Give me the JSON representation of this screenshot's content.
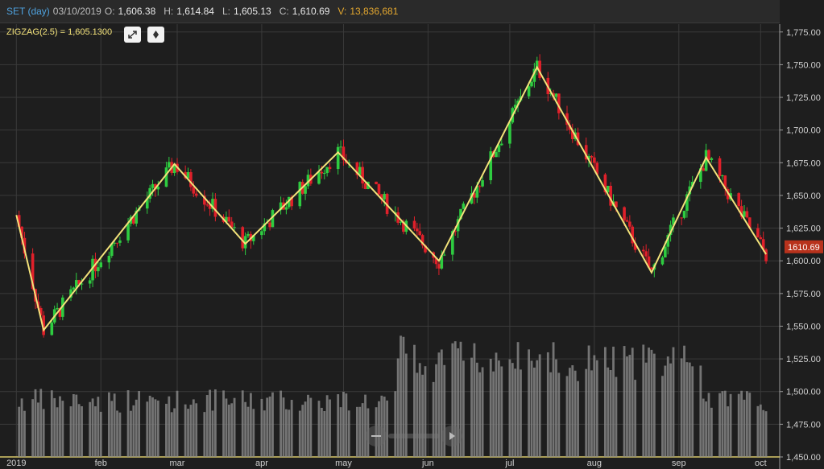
{
  "header": {
    "symbol": "SET (day)",
    "date": "03/10/2019",
    "open_label": "O:",
    "open": "1,606.38",
    "high_label": "H:",
    "high": "1,614.84",
    "low_label": "L:",
    "low": "1,605.13",
    "close_label": "C:",
    "close": "1,610.69",
    "volume_label": "V:",
    "volume": "13,836,681"
  },
  "indicator": {
    "label": "ZIGZAG(2.5) = 1,605.1300"
  },
  "controls": {
    "expand_icon": "expand-arrows-icon",
    "diamond_icon": "diamond-icon"
  },
  "colors": {
    "background": "#1e1e1e",
    "grid": "#3a3a3a",
    "up": "#2ecc40",
    "down": "#e0202a",
    "zigzag": "#f3e27a",
    "volume": "#8a8a8a",
    "last_price_tag": "#b8321c",
    "bottom_line": "#d9c86a"
  },
  "chart_data": {
    "type": "candlestick",
    "y_ticks": [
      "1,775.00",
      "1,750.00",
      "1,725.00",
      "1,700.00",
      "1,675.00",
      "1,650.00",
      "1,625.00",
      "1,600.00",
      "1,575.00",
      "1,550.00",
      "1,525.00",
      "1,500.00",
      "1,475.00",
      "1,450.00"
    ],
    "ylim": [
      1450,
      1781
    ],
    "x_ticks": [
      "2019",
      "feb",
      "mar",
      "apr",
      "may",
      "jun",
      "jul",
      "aug",
      "sep",
      "oct"
    ],
    "last_price": "1610.69",
    "zigzag_points": [
      {
        "x": "2019-01-01",
        "y": 1635
      },
      {
        "x": "2019-01-11",
        "y": 1547
      },
      {
        "x": "2019-02-28",
        "y": 1674
      },
      {
        "x": "2019-03-26",
        "y": 1613
      },
      {
        "x": "2019-04-29",
        "y": 1683
      },
      {
        "x": "2019-06-05",
        "y": 1600
      },
      {
        "x": "2019-07-11",
        "y": 1748
      },
      {
        "x": "2019-08-22",
        "y": 1591
      },
      {
        "x": "2019-09-11",
        "y": 1679
      },
      {
        "x": "2019-10-03",
        "y": 1605
      }
    ]
  }
}
